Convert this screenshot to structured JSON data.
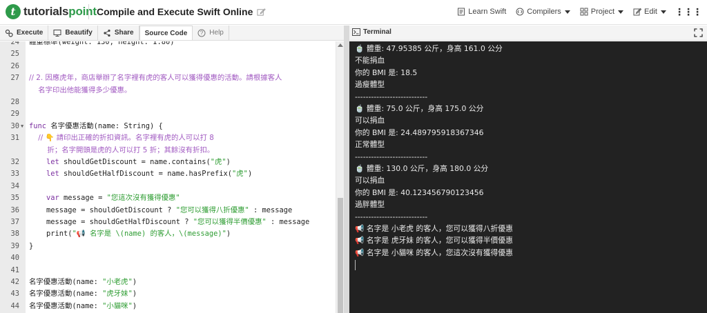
{
  "header": {
    "logo_mark": "t",
    "logo_prefix": "tutorials",
    "logo_suffix": "point",
    "title": "Compile and Execute Swift Online",
    "nav": {
      "learn": "Learn Swift",
      "compilers": "Compilers",
      "project": "Project",
      "edit": "Edit"
    }
  },
  "toolbar": {
    "execute": "Execute",
    "beautify": "Beautify",
    "share": "Share",
    "source_code": "Source Code",
    "help": "Help"
  },
  "editor": {
    "lines": [
      {
        "n": "24",
        "text": "體重標準(weight: 130, height: 1.80)"
      },
      {
        "n": "25",
        "text": ""
      },
      {
        "n": "26",
        "text": ""
      },
      {
        "n": "27",
        "comment": "// 2. 因應虎年，商店舉辦了名字裡有虎的客人可以獲得優惠的活動。請根據客人"
      },
      {
        "n": "",
        "comment": "    名字印出他能獲得多少優惠。"
      },
      {
        "n": "28",
        "text": ""
      },
      {
        "n": "29",
        "text": ""
      },
      {
        "n": "30",
        "kw": "func",
        "text": " 名字優惠活動(name: String) {"
      },
      {
        "n": "31",
        "comment": "    // 👇 請印出正確的折扣資訊。名字裡有虎的人可以打 8"
      },
      {
        "n": "",
        "comment": "        折；名字開頭是虎的人可以打 5 折；其餘沒有折扣。"
      },
      {
        "n": "32",
        "kw": "    let",
        "text": " shouldGetDiscount = name.contains(",
        "str": "\"虎\"",
        "tail": ")"
      },
      {
        "n": "33",
        "kw": "    let",
        "text": " shouldGetHalfDiscount = name.hasPrefix(",
        "str": "\"虎\"",
        "tail": ")"
      },
      {
        "n": "34",
        "text": ""
      },
      {
        "n": "35",
        "kw": "    var",
        "text": " message = ",
        "str": "\"您這次沒有獲得優惠\"",
        "tail": ""
      },
      {
        "n": "36",
        "text": "    message = shouldGetDiscount ? ",
        "str": "\"您可以獲得八折優惠\"",
        "tail": " : message"
      },
      {
        "n": "37",
        "text": "    message = shouldGetHalfDiscount ? ",
        "str": "\"您可以獲得半價優惠\"",
        "tail": " : message"
      },
      {
        "n": "38",
        "text": "    print(",
        "str": "\"📢 名字是 \\(name) 的客人，\\(message)\"",
        "tail": ")"
      },
      {
        "n": "39",
        "text": "}"
      },
      {
        "n": "40",
        "text": ""
      },
      {
        "n": "41",
        "text": ""
      },
      {
        "n": "42",
        "text": "名字優惠活動(name: ",
        "str": "\"小老虎\"",
        "tail": ")"
      },
      {
        "n": "43",
        "text": "名字優惠活動(name: ",
        "str": "\"虎牙妹\"",
        "tail": ")"
      },
      {
        "n": "44",
        "text": "名字優惠活動(name: ",
        "str": "\"小貓咪\"",
        "tail": ")"
      }
    ]
  },
  "terminal": {
    "tab_label": "Terminal",
    "lines": [
      "🍵 體重: 47.95385 公斤，身高 161.0 公分",
      "不能捐血",
      "你的 BMI 是: 18.5",
      "過瘦體型",
      "---------------------------",
      "🍵 體重: 75.0 公斤，身高 175.0 公分",
      "可以捐血",
      "你的 BMI 是: 24.489795918367346",
      "正常體型",
      "---------------------------",
      "🍵 體重: 130.0 公斤，身高 180.0 公分",
      "可以捐血",
      "你的 BMI 是: 40.123456790123456",
      "過胖體型",
      "---------------------------",
      "📢 名字是 小老虎 的客人，您可以獲得八折優惠",
      "📢 名字是 虎牙妹 的客人，您可以獲得半價優惠",
      "📢 名字是 小貓咪 的客人，您這次沒有獲得優惠"
    ]
  },
  "colors": {
    "brand_green": "#2e9a4a",
    "comment": "#a25bc2",
    "string": "#2f9d33",
    "keyword": "#7b2fa0",
    "terminal_bg": "#222222"
  }
}
